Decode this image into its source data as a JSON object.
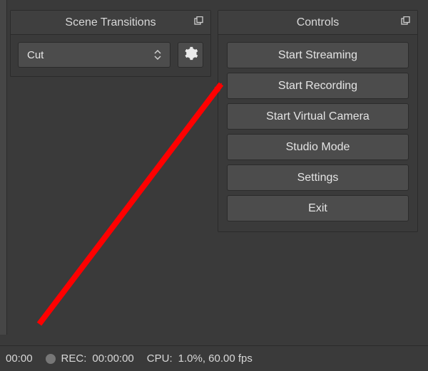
{
  "scene_transitions": {
    "title": "Scene Transitions",
    "selected": "Cut"
  },
  "controls": {
    "title": "Controls",
    "buttons": [
      "Start Streaming",
      "Start Recording",
      "Start Virtual Camera",
      "Studio Mode",
      "Settings",
      "Exit"
    ]
  },
  "statusbar": {
    "stream_time": "00:00",
    "rec_label": "REC:",
    "rec_time": "00:00:00",
    "cpu_label": "CPU:",
    "cpu_value": "1.0%, 60.00 fps"
  },
  "annotation": {
    "color": "#ff0000"
  }
}
